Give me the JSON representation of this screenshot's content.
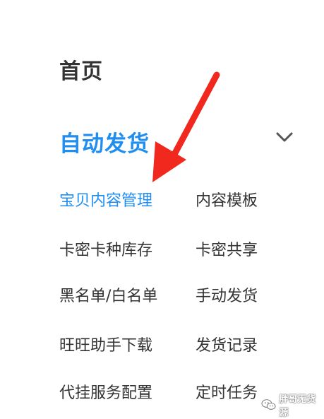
{
  "menu": {
    "home_label": "首页",
    "section": {
      "title": "自动发货",
      "expanded": true,
      "chevron_icon": "chevron-down-icon",
      "active_color": "#1f8ef0",
      "items": [
        {
          "label": "宝贝内容管理",
          "active": true
        },
        {
          "label": "内容模板",
          "active": false
        },
        {
          "label": "卡密卡种库存",
          "active": false
        },
        {
          "label": "卡密共享",
          "active": false
        },
        {
          "label": "黑名单/白名单",
          "active": false
        },
        {
          "label": "手动发货",
          "active": false
        },
        {
          "label": "旺旺助手下载",
          "active": false
        },
        {
          "label": "发货记录",
          "active": false
        },
        {
          "label": "代挂服务配置",
          "active": false
        },
        {
          "label": "定时任务",
          "active": false
        }
      ]
    }
  },
  "annotation": {
    "arrow_icon": "red-arrow-icon",
    "arrow_color": "#f0281e"
  },
  "watermark": {
    "icon": "wechat-icon",
    "text": "胖哥无货源"
  }
}
